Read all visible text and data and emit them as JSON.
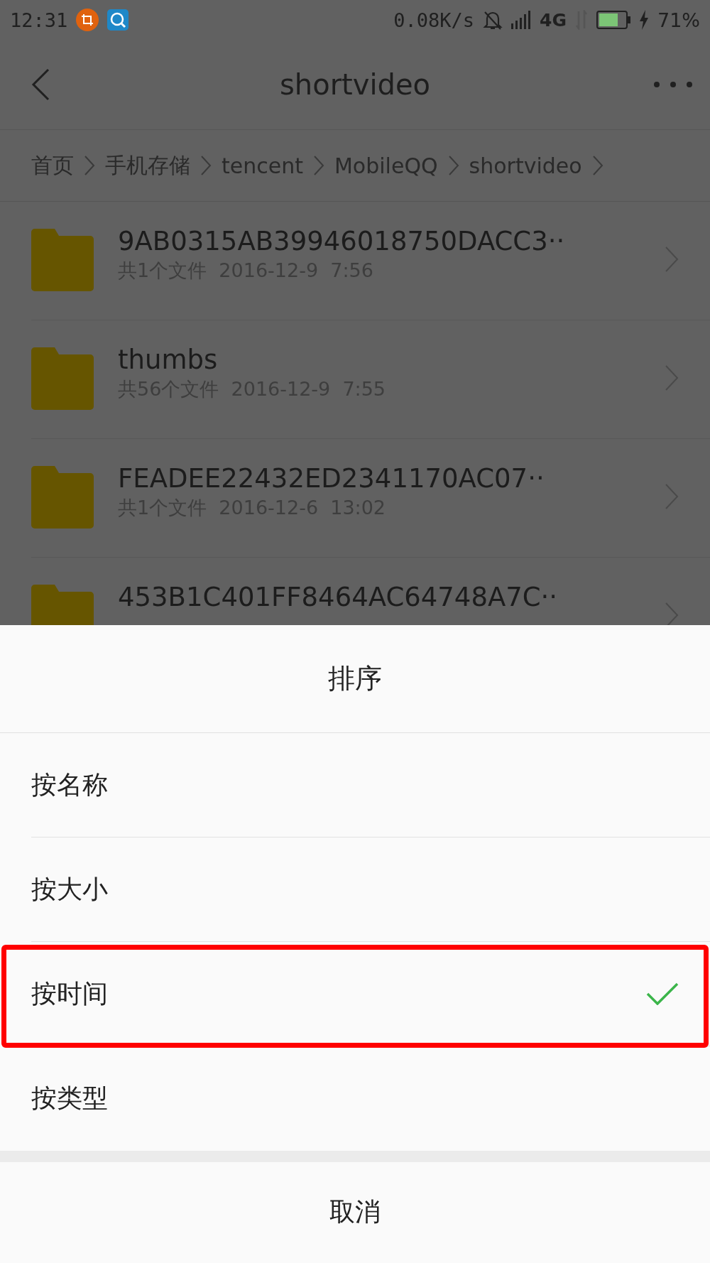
{
  "status_bar": {
    "time": "12:31",
    "speed": "0.08K/s",
    "network": "4G",
    "battery": "71%"
  },
  "header": {
    "title": "shortvideo"
  },
  "breadcrumb": [
    "首页",
    "手机存储",
    "tencent",
    "MobileQQ",
    "shortvideo"
  ],
  "files": [
    {
      "name": "9AB0315AB39946018750DACC3··",
      "info": "共1个文件  2016-12-9  7:56"
    },
    {
      "name": "thumbs",
      "info": "共56个文件  2016-12-9  7:55"
    },
    {
      "name": "FEADEE22432ED2341170AC07··",
      "info": "共1个文件  2016-12-6  13:02"
    },
    {
      "name": "453B1C401FF8464AC64748A7C··"
    }
  ],
  "sort_sheet": {
    "title": "排序",
    "options": [
      {
        "label": "按名称",
        "selected": false,
        "highlighted": false
      },
      {
        "label": "按大小",
        "selected": false,
        "highlighted": false
      },
      {
        "label": "按时间",
        "selected": true,
        "highlighted": true
      },
      {
        "label": "按类型",
        "selected": false,
        "highlighted": false
      }
    ],
    "cancel": "取消"
  }
}
